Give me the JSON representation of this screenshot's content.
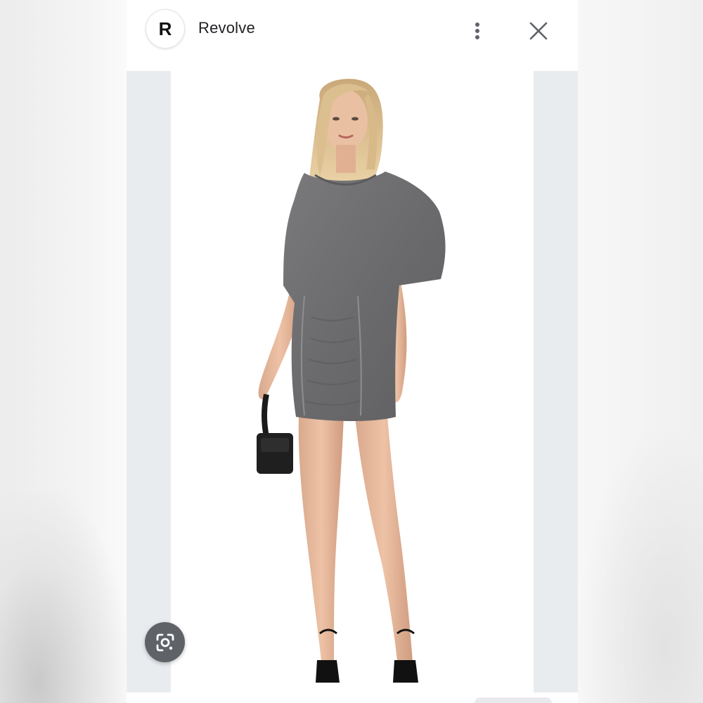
{
  "header": {
    "logo_letter": "R",
    "site_name": "Revolve"
  },
  "icons": {
    "more": "more-vert-icon",
    "close": "close-icon",
    "lens": "google-lens-icon"
  },
  "colors": {
    "dress": "#6e6e70",
    "frame": "#e9ecef",
    "lens_button": "#5f6368"
  }
}
